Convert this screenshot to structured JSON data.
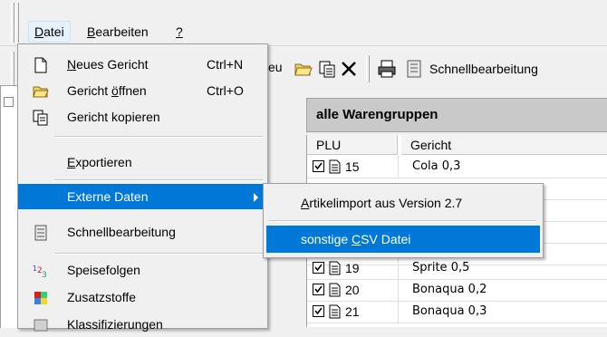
{
  "menubar": {
    "items": [
      {
        "id": "datei",
        "label": "Datei",
        "accel": "D"
      },
      {
        "id": "bearbeiten",
        "label": "Bearbeiten",
        "accel": "B"
      },
      {
        "id": "help",
        "label": "?"
      }
    ]
  },
  "toolbar": {
    "partial_label": "eu",
    "schnell_label": "Schnellbearbeitung"
  },
  "group_header": "alle Warengruppen",
  "grid": {
    "columns": [
      "PLU",
      "Gericht"
    ],
    "rows": [
      {
        "plu": "15",
        "name": "Cola 0,3"
      },
      {
        "plu": "19",
        "name": "Sprite 0,5"
      },
      {
        "plu": "20",
        "name": "Bonaqua 0,2"
      },
      {
        "plu": "21",
        "name": "Bonaqua 0,3"
      }
    ]
  },
  "menu": {
    "items": [
      {
        "label": "Neues Gericht",
        "shortcut": "Ctrl+N",
        "icon": "new-document-icon"
      },
      {
        "label": "Gericht öffnen",
        "shortcut": "Ctrl+O",
        "icon": "open-folder-icon"
      },
      {
        "label": "Gericht kopieren",
        "icon": "copy-icon"
      },
      {
        "label": "Exportieren"
      },
      {
        "label": "Externe Daten",
        "selected": true
      },
      {
        "label": "Schnellbearbeitung",
        "icon": "quick-edit-icon"
      },
      {
        "label": "Speisefolgen",
        "icon": "menu-sequence-icon"
      },
      {
        "label": "Zusatzstoffe",
        "icon": "additives-icon"
      },
      {
        "label": "Klassifizierungen",
        "icon": "classification-icon"
      }
    ]
  },
  "submenu": {
    "items": [
      {
        "label": "Artikelimport aus Version 2.7"
      },
      {
        "label": "sonstige CSV Datei",
        "selected": true
      }
    ]
  },
  "colors": {
    "highlight": "#0078d7",
    "menu_bg": "#f0f0f0",
    "header_bg": "#c9c9c9"
  }
}
